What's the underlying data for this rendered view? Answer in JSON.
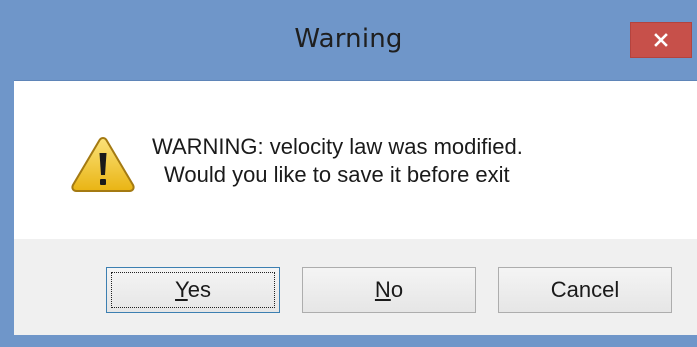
{
  "window": {
    "title": "Warning",
    "close_icon": "close-icon"
  },
  "message": {
    "icon": "warning-icon",
    "line1": "WARNING: velocity law was modified.",
    "line2": "Would you like to save it before exit"
  },
  "buttons": {
    "yes": {
      "mnemonic": "Y",
      "rest": "es"
    },
    "no": {
      "mnemonic": "N",
      "rest": "o"
    },
    "cancel": "Cancel"
  },
  "colors": {
    "frame": "#6f96c9",
    "close_button": "#c7504a",
    "button_bar": "#f0f0f0",
    "warning_yellow": "#f6c928"
  }
}
